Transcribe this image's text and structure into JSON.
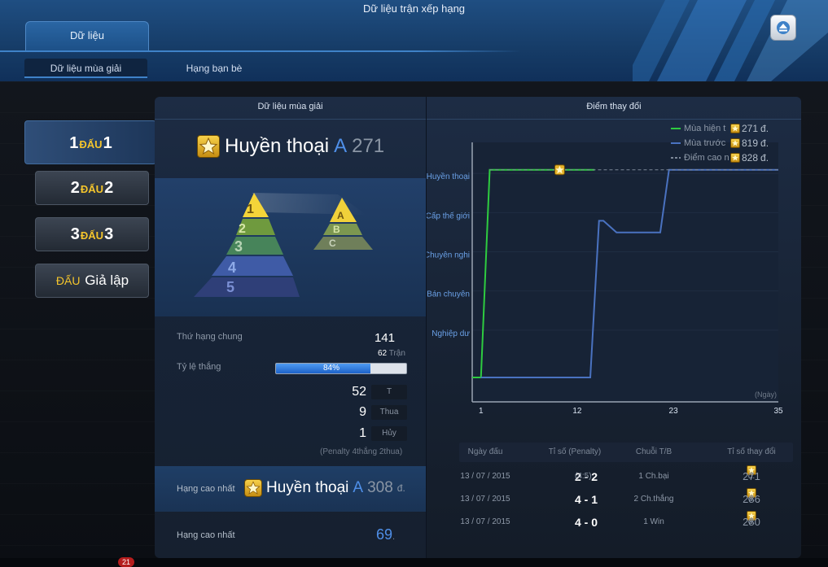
{
  "window": {
    "title": "Dữ liệu trận xếp hạng"
  },
  "tabs": {
    "main": "Dữ liệu",
    "sub": [
      "Dữ liệu mùa giải",
      "Hạng bạn bè"
    ]
  },
  "modes": [
    {
      "num1": "1",
      "word": "ĐẤU",
      "num2": "1"
    },
    {
      "num1": "2",
      "word": "ĐẤU",
      "num2": "2"
    },
    {
      "num1": "3",
      "word": "ĐẤU",
      "num2": "3"
    },
    {
      "word": "ĐẤU",
      "name": "Giả lập"
    }
  ],
  "season": {
    "header": "Dữ liệu mùa giải",
    "rank_name": "Huyền thoại",
    "rank_grade": "A",
    "rank_points": "271",
    "pyramid_tiers": [
      "1",
      "2",
      "3",
      "4",
      "5"
    ],
    "sub_tiers": [
      "A",
      "B",
      "C"
    ],
    "overall_label": "Thứ hạng chung",
    "overall_value": "141",
    "matches_value": "62",
    "matches_unit": "Trận",
    "winrate_label": "Tỷ lệ thắng",
    "winrate_text": "84%",
    "winrate_fraction": 0.84,
    "counts": [
      {
        "value": "52",
        "label": "T"
      },
      {
        "value": "9",
        "label": "Thua"
      },
      {
        "value": "1",
        "label": "Hủy"
      }
    ],
    "penalty_note": "(Penalty 4thắng 2thua)",
    "best_label": "Hạng cao nhất",
    "best_rank_name": "Huyền thoại",
    "best_rank_grade": "A",
    "best_rank_points": "308",
    "best_rank_unit": "đ.",
    "best_label_2": "Hạng cao nhất",
    "best_value_2": "69",
    "best_value_2_unit": "."
  },
  "chart_data": {
    "type": "line",
    "title": "Điểm thay đổi",
    "xlabel": "(Ngày)",
    "ylabel": "",
    "x_ticks": [
      1,
      12,
      23,
      35
    ],
    "xlim": [
      0,
      35
    ],
    "y_tiers": [
      "Huyền thoại",
      "Cấp thế giới",
      "Chuyên nghi",
      "Bán chuyên",
      "Nghiệp dư"
    ],
    "ylim": [
      0,
      6
    ],
    "legend_placement": "top-right",
    "series": [
      {
        "name": "Mùa hiện t",
        "value_label": "271",
        "unit": "đ.",
        "color": "#2ecc40",
        "points": [
          [
            0,
            0
          ],
          [
            1,
            0
          ],
          [
            2,
            5.3
          ],
          [
            14,
            5.3
          ]
        ]
      },
      {
        "name": "Mùa trước",
        "value_label": "819",
        "unit": "đ.",
        "color": "#4a72c0",
        "points": [
          [
            1,
            0
          ],
          [
            13.5,
            0
          ],
          [
            14.5,
            4.0
          ],
          [
            15,
            4.0
          ],
          [
            16.5,
            3.7
          ],
          [
            21.5,
            3.7
          ],
          [
            22.5,
            5.3
          ],
          [
            35,
            5.3
          ]
        ]
      },
      {
        "name": "Điểm cao n",
        "value_label": "828",
        "unit": "đ.",
        "color": "#7d8898",
        "dashed": true,
        "points": [
          [
            2,
            5.3
          ],
          [
            35,
            5.3
          ]
        ]
      }
    ],
    "marker": {
      "x": 10,
      "y": 5.3,
      "icon": "star-badge-icon"
    }
  },
  "history": {
    "headers": [
      "Ngày đấu",
      "Tỉ số (Penalty)",
      "Chuỗi T/B",
      "Tỉ số thay đổi"
    ],
    "rows": [
      {
        "date": "13 / 07 / 2015",
        "score": "2 - 2",
        "penalty": "(4:5)",
        "streak": "1 Ch.bại",
        "change": "271",
        "unit": "đ.",
        "trend": "down"
      },
      {
        "date": "13 / 07 / 2015",
        "score": "4 - 1",
        "penalty": "",
        "streak": "2 Ch.thắng",
        "change": "286",
        "unit": "đ.",
        "trend": "up"
      },
      {
        "date": "13 / 07 / 2015",
        "score": "4 - 0",
        "penalty": "",
        "streak": "1 Win",
        "change": "280",
        "unit": "đ.",
        "trend": "up"
      }
    ]
  },
  "footer": {
    "notification_count": "21"
  },
  "colors": {
    "accent": "#3f82c8",
    "gold": "#f4c52c",
    "win": "#2ecc40",
    "trend_up": "#2ecc40",
    "trend_down": "#8b96a5"
  }
}
